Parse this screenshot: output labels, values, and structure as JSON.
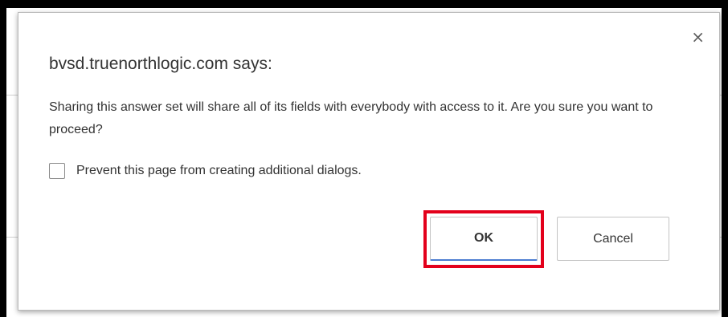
{
  "dialog": {
    "title": "bvsd.truenorthlogic.com says:",
    "message": "Sharing this answer set will share all of its fields with everybody with access to it. Are you sure you want to proceed?",
    "prevent_label": "Prevent this page from creating additional dialogs.",
    "prevent_checked": false,
    "close_glyph": "×",
    "ok_label": "OK",
    "cancel_label": "Cancel"
  },
  "colors": {
    "highlight": "#e3001b",
    "focus_underline": "#4a7bd0"
  },
  "icons": [
    "close-icon"
  ]
}
